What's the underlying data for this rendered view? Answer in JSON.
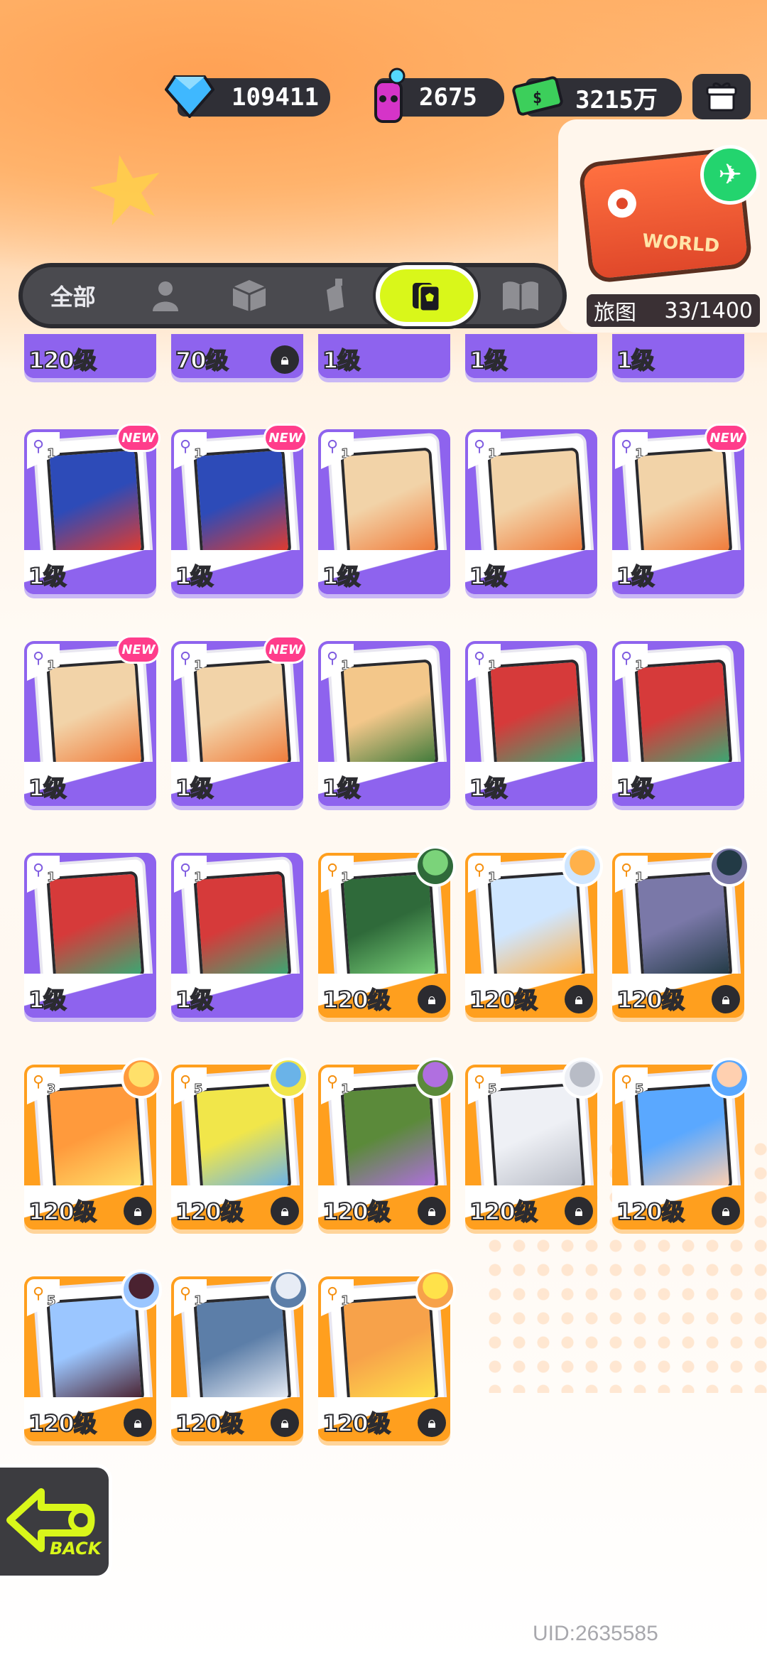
{
  "currencies": {
    "gems": "109411",
    "spray": "2675",
    "cash": "3215万"
  },
  "travel_map": {
    "case_text": "WORLD",
    "label": "旅图",
    "progress": "33/1400"
  },
  "tabs": [
    {
      "label": "全部",
      "icon": "all"
    },
    {
      "label": "",
      "icon": "person-icon"
    },
    {
      "label": "",
      "icon": "box-icon"
    },
    {
      "label": "",
      "icon": "spray-can-icon"
    },
    {
      "label": "",
      "icon": "card-icon",
      "active": true
    },
    {
      "label": "",
      "icon": "book-icon"
    }
  ],
  "partial_row": [
    {
      "level": "120级",
      "locked": false
    },
    {
      "level": "70级",
      "locked": true
    },
    {
      "level": "1级",
      "locked": false
    },
    {
      "level": "1级",
      "locked": false
    },
    {
      "level": "1级",
      "locked": false
    }
  ],
  "cards": [
    {
      "level": "1级",
      "color": "purple",
      "role": "1",
      "new": true,
      "art": "football-player"
    },
    {
      "level": "1级",
      "color": "purple",
      "role": "1",
      "new": true,
      "art": "football-player"
    },
    {
      "level": "1级",
      "color": "purple",
      "role": "1",
      "new": false,
      "art": "bear"
    },
    {
      "level": "1级",
      "color": "purple",
      "role": "1",
      "new": false,
      "art": "bear"
    },
    {
      "level": "1级",
      "color": "purple",
      "role": "1",
      "new": true,
      "art": "bear"
    },
    {
      "level": "1级",
      "color": "purple",
      "role": "1",
      "new": true,
      "art": "bear"
    },
    {
      "level": "1级",
      "color": "purple",
      "role": "1",
      "new": true,
      "art": "bear"
    },
    {
      "level": "1级",
      "color": "purple",
      "role": "1",
      "new": false,
      "art": "legs"
    },
    {
      "level": "1级",
      "color": "purple",
      "role": "1",
      "new": false,
      "art": "fish"
    },
    {
      "level": "1级",
      "color": "purple",
      "role": "1",
      "new": false,
      "art": "fish"
    },
    {
      "level": "1级",
      "color": "purple",
      "role": "1",
      "new": false,
      "art": "fish"
    },
    {
      "level": "1级",
      "color": "purple",
      "role": "1",
      "new": false,
      "art": "fish"
    },
    {
      "level": "120级",
      "color": "orange",
      "role": "1",
      "locked": true,
      "art": "green-hair"
    },
    {
      "level": "120级",
      "color": "orange",
      "role": "1",
      "locked": true,
      "art": "orange-hair"
    },
    {
      "level": "120级",
      "color": "orange",
      "role": "1",
      "locked": true,
      "art": "dark-hair"
    },
    {
      "level": "120级",
      "color": "orange",
      "role": "3",
      "locked": true,
      "art": "blonde"
    },
    {
      "level": "120级",
      "color": "orange",
      "role": "5",
      "locked": true,
      "art": "yellow-robot"
    },
    {
      "level": "120级",
      "color": "orange",
      "role": "1",
      "locked": true,
      "art": "purple-hair"
    },
    {
      "level": "120级",
      "color": "orange",
      "role": "5",
      "locked": true,
      "art": "silver-hair"
    },
    {
      "level": "120级",
      "color": "orange",
      "role": "5",
      "locked": true,
      "art": "blue-hair"
    },
    {
      "level": "120级",
      "color": "orange",
      "role": "5",
      "locked": true,
      "art": "black-hair"
    },
    {
      "level": "120级",
      "color": "orange",
      "role": "1",
      "locked": true,
      "art": "white-hair"
    },
    {
      "level": "120级",
      "color": "orange",
      "role": "1",
      "locked": true,
      "art": "yellow-hat"
    }
  ],
  "back_button": {
    "label": "BACK"
  },
  "uid": "UID:2635585"
}
